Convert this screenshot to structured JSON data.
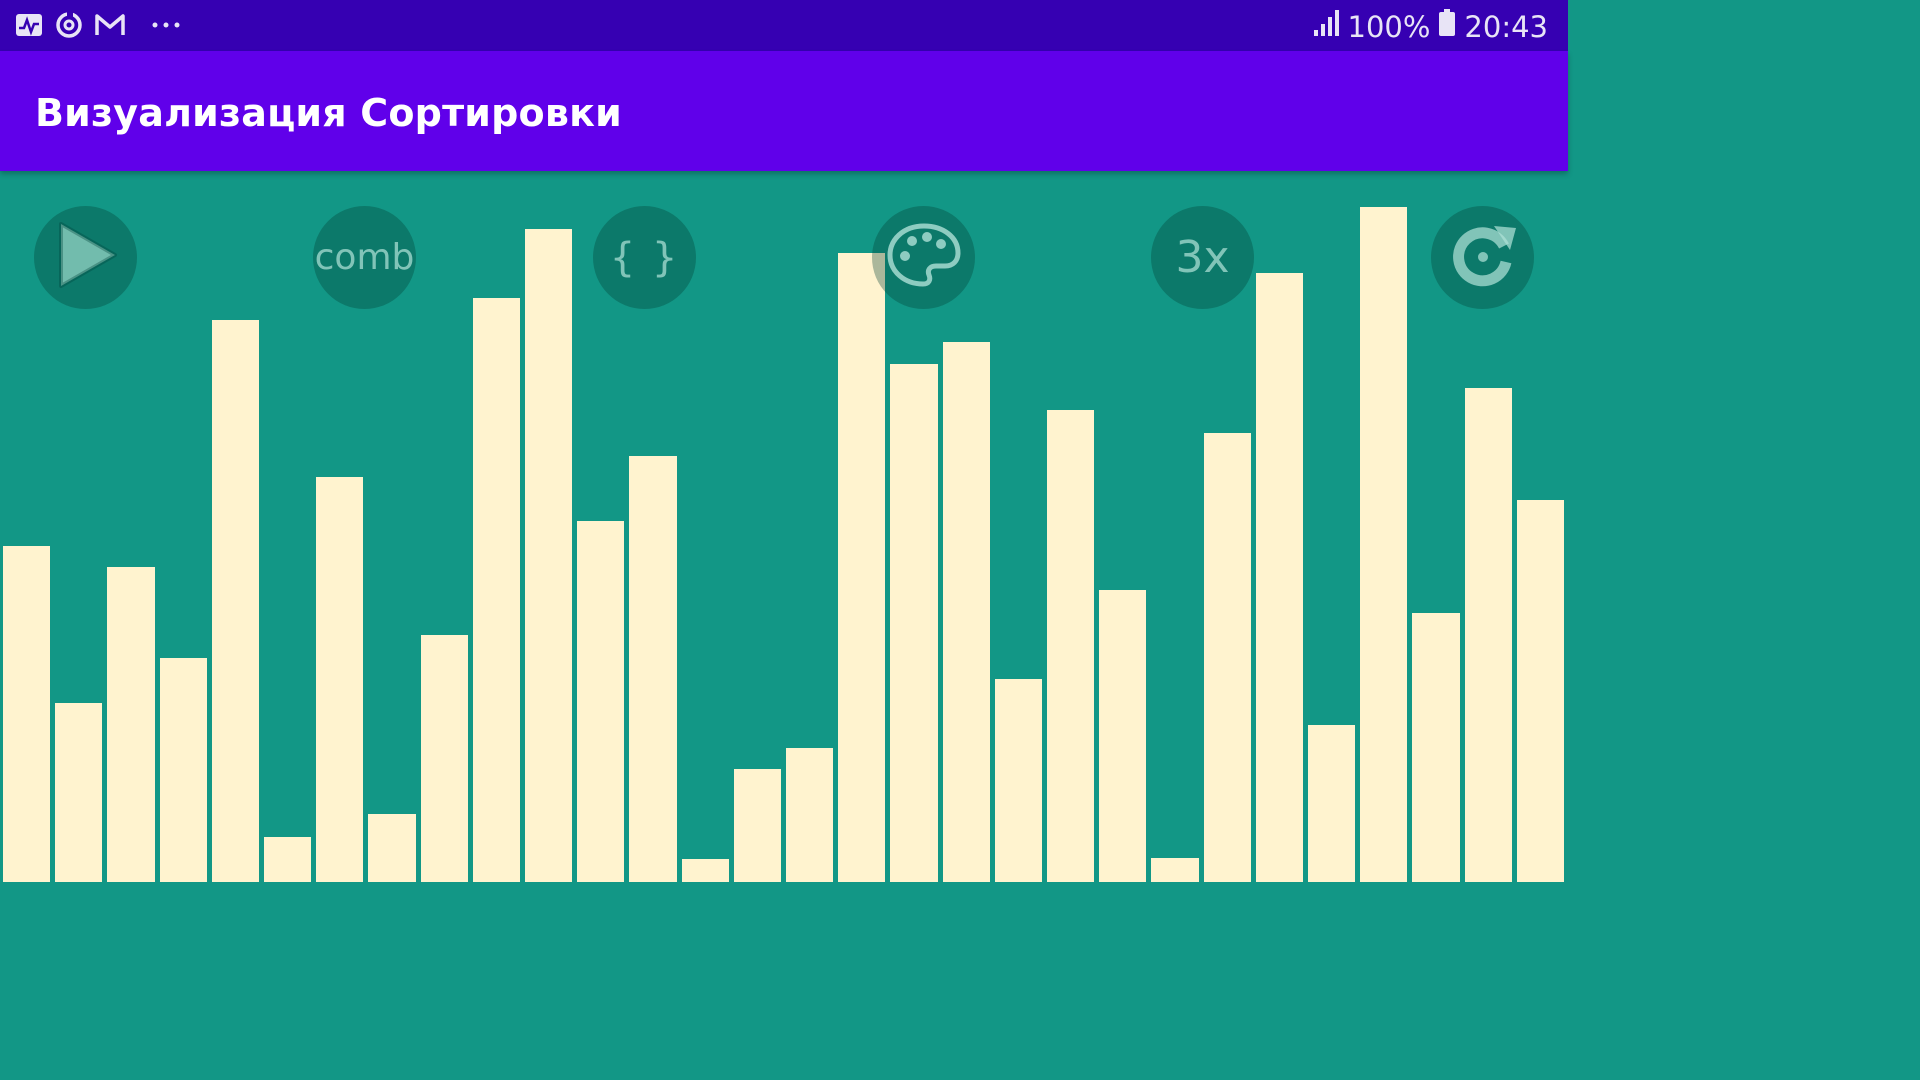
{
  "status_bar": {
    "left_icons": [
      "activity-icon",
      "sync-icon",
      "mail-icon",
      "more-dots-icon"
    ],
    "battery_percent": "100%",
    "time": "20:43"
  },
  "toolbar": {
    "title": "Визуализация Сортировки"
  },
  "controls": {
    "play_icon": "play-icon",
    "algorithm_label": "comb",
    "code_label": "{ }",
    "palette_icon": "palette-icon",
    "speed_label": "3x",
    "reset_icon": "refresh-icon"
  },
  "colors": {
    "status_bar": "#3600b2",
    "toolbar": "#6000ea",
    "background": "#129786",
    "bar": "#fff3cf"
  },
  "chart_data": {
    "type": "bar",
    "grid": false,
    "ylim": [
      0,
      1
    ],
    "values": [
      0.473,
      0.252,
      0.443,
      0.315,
      0.791,
      0.063,
      0.569,
      0.095,
      0.347,
      0.822,
      0.918,
      0.508,
      0.599,
      0.033,
      0.159,
      0.189,
      0.885,
      0.728,
      0.759,
      0.285,
      0.664,
      0.411,
      0.034,
      0.632,
      0.856,
      0.221,
      0.95,
      0.379,
      0.695,
      0.537
    ]
  }
}
